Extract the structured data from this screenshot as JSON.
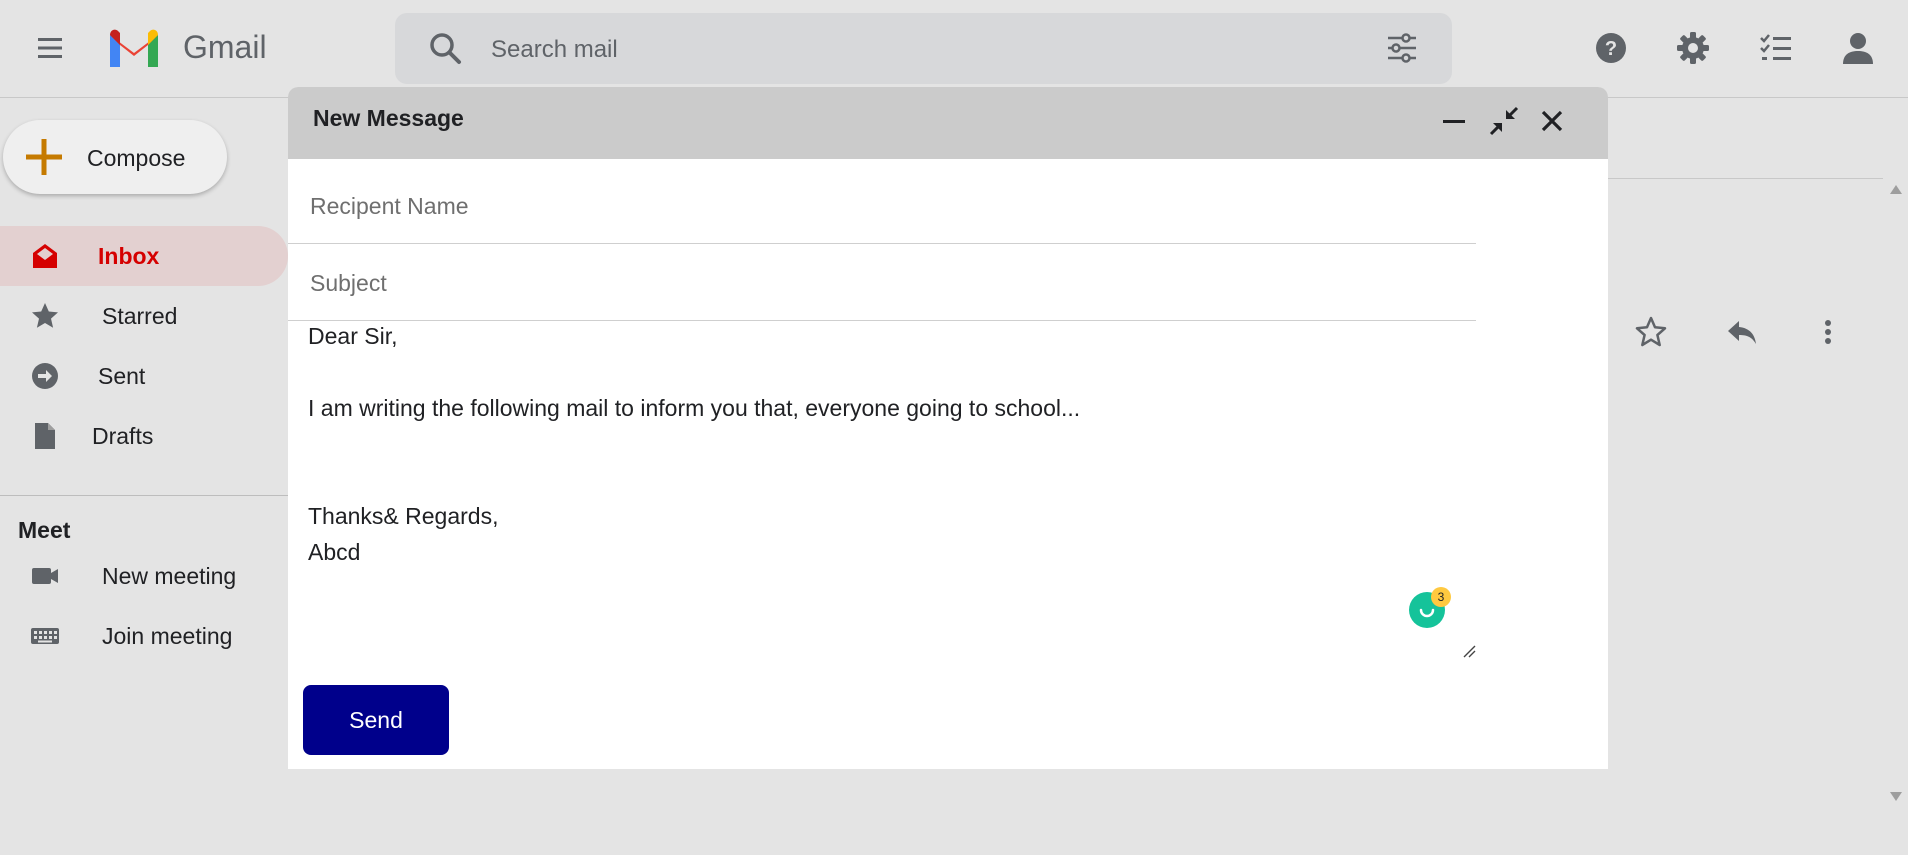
{
  "header": {
    "brand": "Gmail",
    "search_placeholder": "Search mail",
    "icons": [
      "menu-icon",
      "gmail-logo",
      "search-icon",
      "filter-icon",
      "help-icon",
      "gear-icon",
      "tasks-icon",
      "account-icon"
    ]
  },
  "sidebar": {
    "compose_label": "Compose",
    "items": [
      {
        "label": "Inbox",
        "icon": "inbox-icon",
        "active": true
      },
      {
        "label": "Starred",
        "icon": "star-icon"
      },
      {
        "label": "Sent",
        "icon": "sent-icon"
      },
      {
        "label": "Drafts",
        "icon": "drafts-icon"
      }
    ],
    "meet": {
      "title": "Meet",
      "items": [
        {
          "label": "New meeting",
          "icon": "video-icon"
        },
        {
          "label": "Join meeting",
          "icon": "keyboard-icon"
        }
      ]
    }
  },
  "message_actions": [
    "star-icon",
    "reply-icon",
    "more-vert-icon"
  ],
  "compose_dialog": {
    "title": "New Message",
    "recipient_placeholder": "Recipent Name",
    "subject_placeholder": "Subject",
    "body_lines": [
      "Dear Sir,",
      "I am writing the following mail to inform you that, everyone going to school...",
      "Thanks& Regards,",
      "Abcd"
    ],
    "grammarly_count": "3",
    "send_label": "Send"
  },
  "colors": {
    "background": "#e4e4e4",
    "active_nav_bg": "#e3d0d0",
    "active_nav_text": "#d50000",
    "dialog_header": "#cbcbcb",
    "send_button": "#00008b",
    "compose_plus": "#c57a00",
    "grammarly": "#15c39a"
  }
}
